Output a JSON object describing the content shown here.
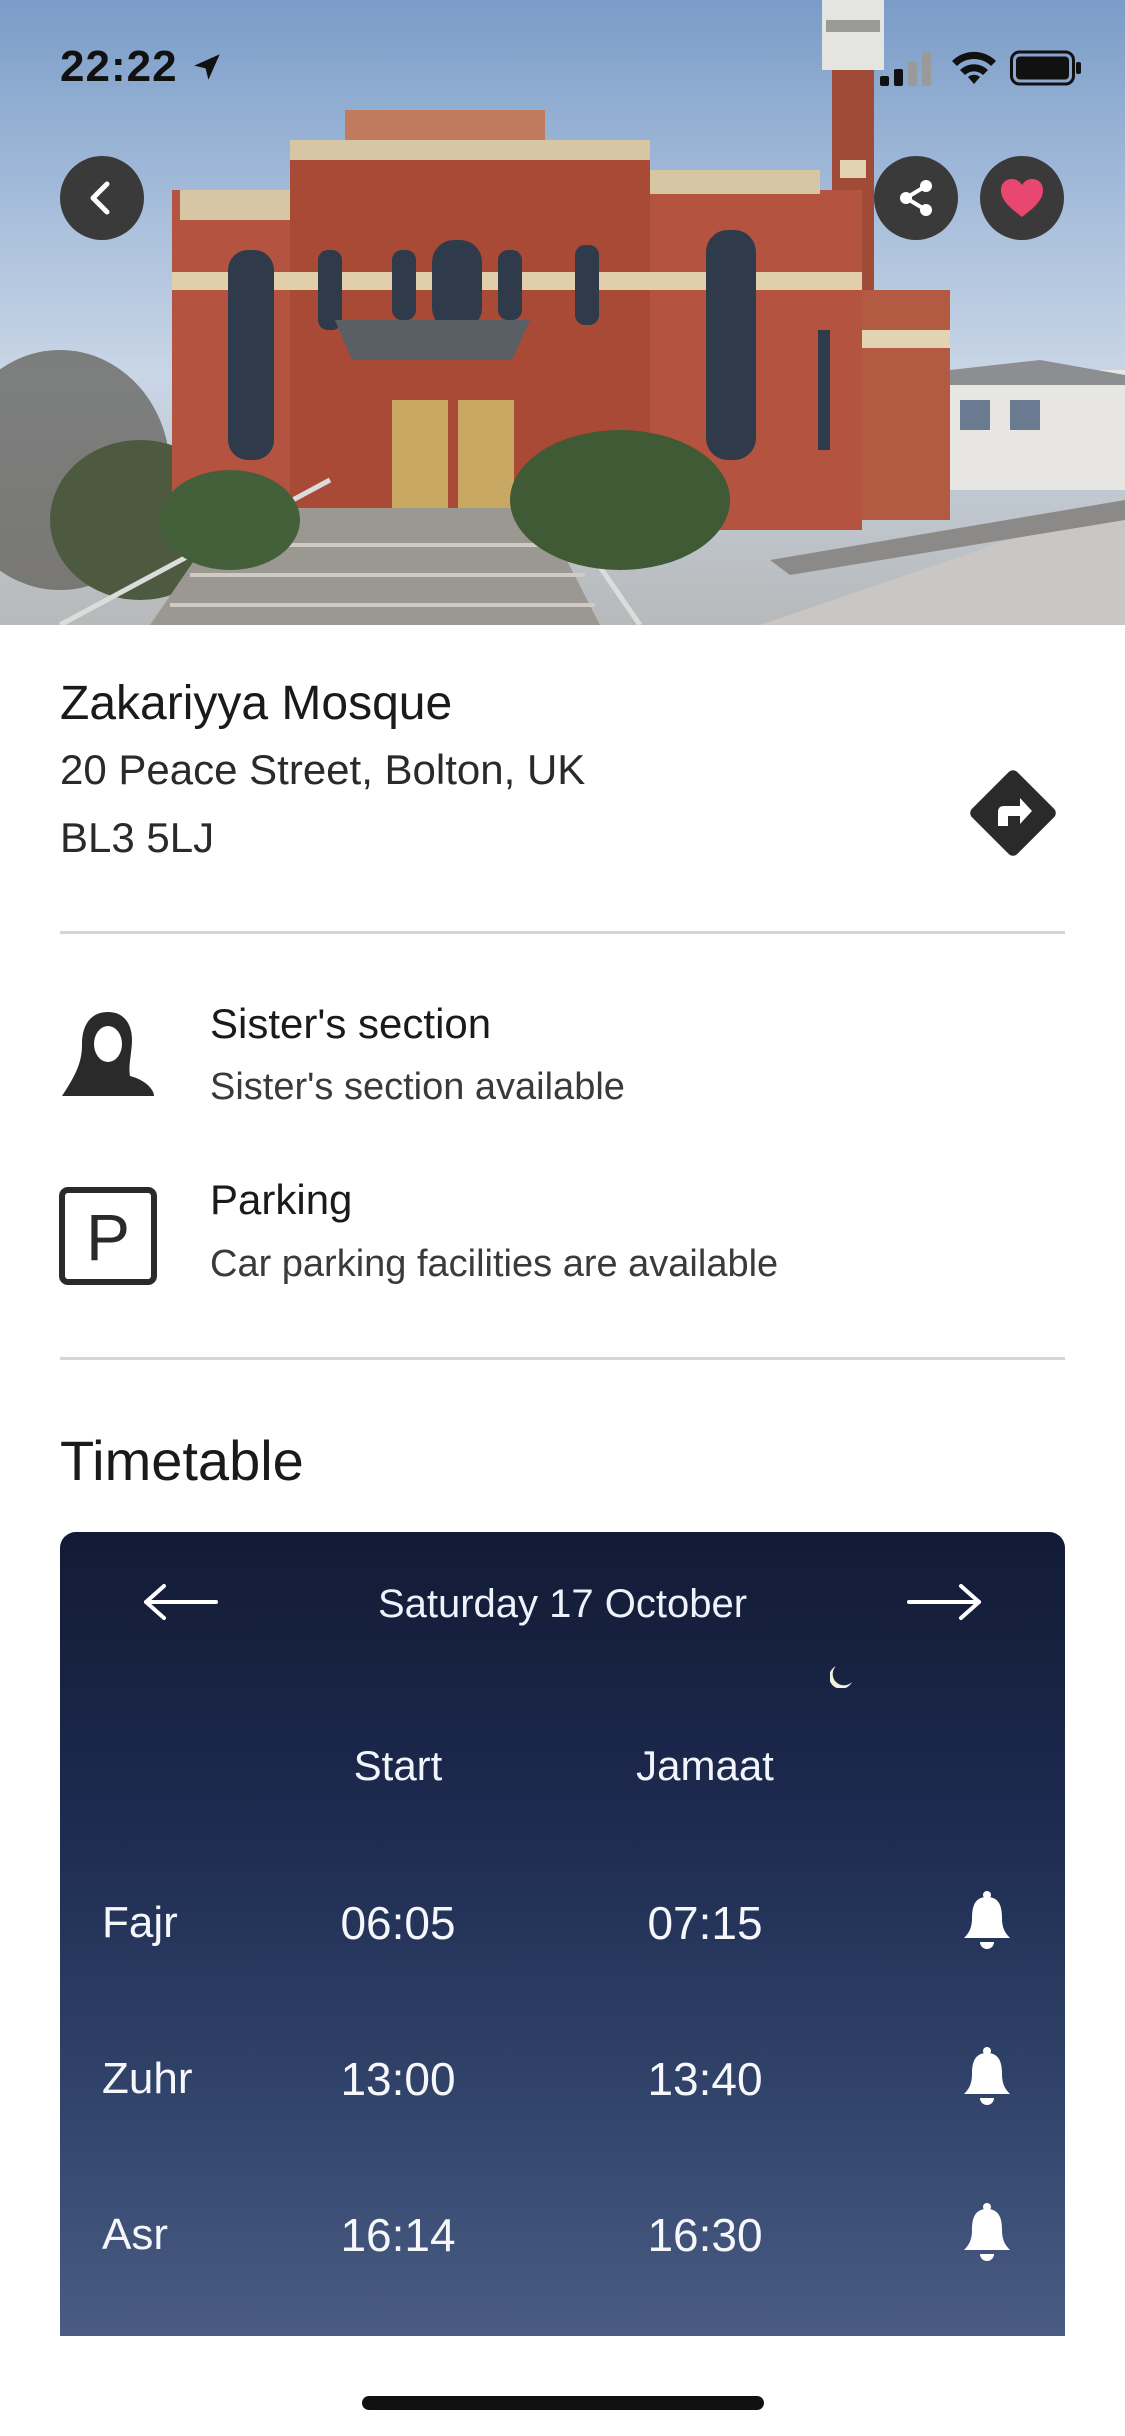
{
  "status_bar": {
    "time": "22:22",
    "icons": [
      "location-arrow-icon",
      "cellular-signal-icon",
      "wifi-icon",
      "battery-icon"
    ]
  },
  "hero": {
    "image": "mosque-building-photo",
    "actions": [
      "back-arrow-icon",
      "share-icon",
      "heart-icon"
    ],
    "heart_color": "#e8476f"
  },
  "mosque": {
    "name": "Zakariyya Mosque",
    "address_line1": "20 Peace Street, Bolton, UK",
    "address_line2": "BL3 5LJ",
    "directions_icon": "directions-icon"
  },
  "facilities": [
    {
      "icon": "sister-hijab-icon",
      "title": "Sister's section",
      "subtitle": "Sister's section available"
    },
    {
      "icon": "parking-icon",
      "title": "Parking",
      "subtitle": "Car parking facilities are available"
    }
  ],
  "timetable": {
    "title": "Timetable",
    "date": "Saturday 17 October",
    "columns": {
      "start": "Start",
      "jamaat": "Jamaat"
    },
    "prayers": [
      {
        "name": "Fajr",
        "start": "06:05",
        "jamaat": "07:15"
      },
      {
        "name": "Zuhr",
        "start": "13:00",
        "jamaat": "13:40"
      },
      {
        "name": "Asr",
        "start": "16:14",
        "jamaat": "16:30"
      }
    ]
  }
}
